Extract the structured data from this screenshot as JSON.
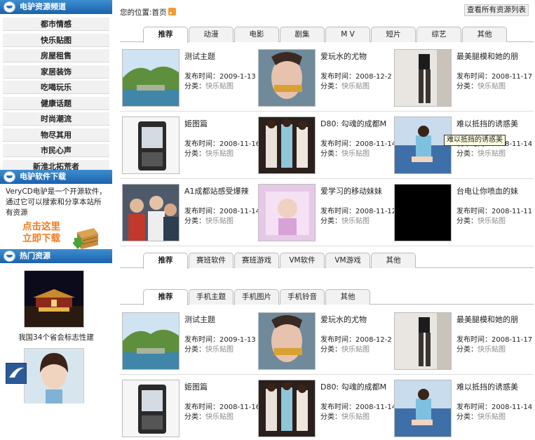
{
  "sidebar": {
    "channel_title": "电驴资源频道",
    "channels": [
      "都市情感",
      "快乐贴图",
      "房屋租售",
      "家居装饰",
      "吃喝玩乐",
      "健康话题",
      "时尚潮流",
      "物尽其用",
      "市民心声",
      "新淮北拓荒者"
    ],
    "software_title": "电驴软件下载",
    "software_desc": "VeryCD电驴是一个开源软件，通过它可以搜索和分享本站所有资源",
    "download_line1": "点击这里",
    "download_line2": "立即下载",
    "hot_title": "热门资源",
    "hot_items": [
      {
        "caption": "我国34个省会标志性建"
      }
    ]
  },
  "header": {
    "location_label": "您的位置:",
    "location_value": "首页",
    "all_resources": "查看所有资源列表"
  },
  "section1": {
    "tabs": [
      "推荐",
      "动漫",
      "电影",
      "剧集",
      "M V",
      "短片",
      "综艺",
      "其他"
    ],
    "cards": [
      {
        "title": "测试主题",
        "date": "2009-1-13",
        "cat": "快乐贴图",
        "thumb": "lake"
      },
      {
        "title": "爱玩水的尤物",
        "date": "2008-12-2",
        "cat": "快乐贴图",
        "thumb": "swim"
      },
      {
        "title": "最美腿模和她的朋",
        "date": "2008-11-17",
        "cat": "快乐贴图",
        "thumb": "legs"
      },
      {
        "title": "姬图篇",
        "date": "2008-11-16",
        "cat": "快乐贴图",
        "thumb": "phone"
      },
      {
        "title": "D80: 勾魂的成都M",
        "date": "2008-11-14",
        "cat": "快乐贴图",
        "thumb": "girls"
      },
      {
        "title": "难以抵挡的诱惑美",
        "date": "2008-11-14",
        "cat": "快乐贴图",
        "thumb": "sofa"
      },
      {
        "title": "A1成都站感受爆辣",
        "date": "2008-11-14",
        "cat": "快乐贴图",
        "thumb": "crowd"
      },
      {
        "title": "爱学习的移动妹妹",
        "date": "2008-11-12",
        "cat": "快乐贴图",
        "thumb": "pink"
      },
      {
        "title": "台电让你喷血的妹",
        "date": "2008-11-11",
        "cat": "快乐贴图",
        "thumb": "black"
      }
    ]
  },
  "section2": {
    "tabs": [
      "推荐",
      "赛班软件",
      "赛班游戏",
      "VM软件",
      "VM游戏",
      "其他"
    ]
  },
  "section3": {
    "tabs": [
      "推荐",
      "手机主题",
      "手机图片",
      "手机铃音",
      "其他"
    ],
    "cards": [
      {
        "title": "测试主题",
        "date": "2009-1-13",
        "cat": "快乐贴图",
        "thumb": "lake"
      },
      {
        "title": "爱玩水的尤物",
        "date": "2008-12-2",
        "cat": "快乐贴图",
        "thumb": "swim"
      },
      {
        "title": "最美腿模和她的朋",
        "date": "2008-11-17",
        "cat": "快乐贴图",
        "thumb": "legs"
      },
      {
        "title": "姬图篇",
        "date": "2008-11-16",
        "cat": "快乐贴图",
        "thumb": "phone"
      },
      {
        "title": "D80: 勾魂的成都M",
        "date": "2008-11-14",
        "cat": "快乐贴图",
        "thumb": "girls"
      },
      {
        "title": "难以抵挡的诱惑美",
        "date": "2008-11-14",
        "cat": "快乐贴图",
        "thumb": "sofa"
      }
    ]
  },
  "labels": {
    "date_prefix": "发布时间：",
    "cat_prefix": "分类："
  },
  "tooltip": "难以抵挡的诱惑美",
  "colors": {
    "header_blue": "#1b62ad",
    "orange": "#f47b20",
    "muted": "#888888"
  }
}
